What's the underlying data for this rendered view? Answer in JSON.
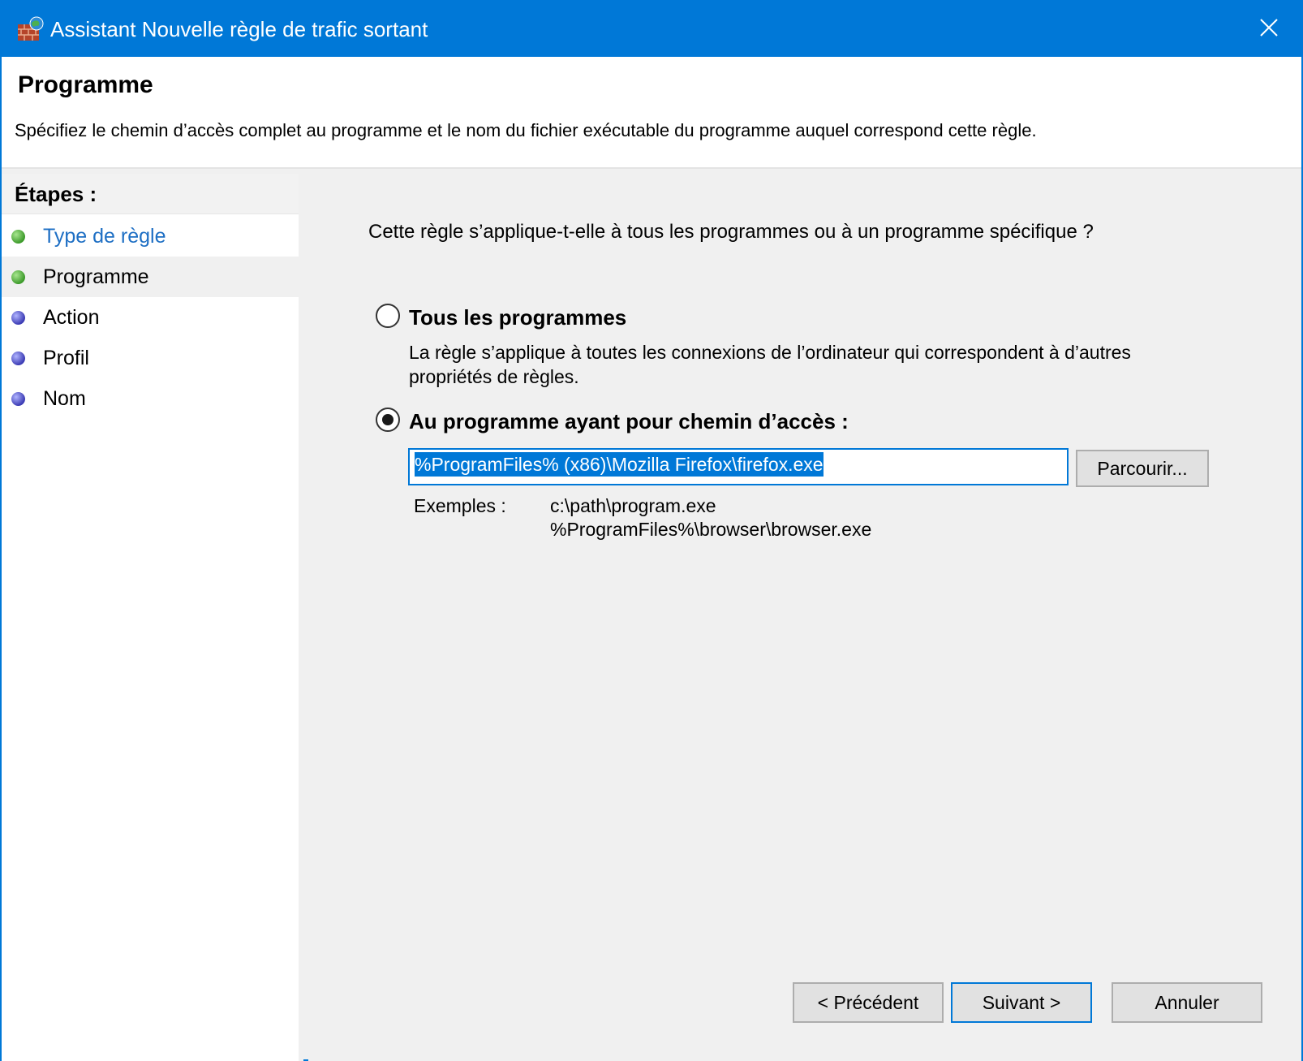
{
  "window": {
    "title": "Assistant Nouvelle règle de trafic sortant",
    "accent_color": "#0078d7"
  },
  "header": {
    "title": "Programme",
    "description": "Spécifiez le chemin d’accès complet au programme et le nom du fichier exécutable du programme auquel correspond cette règle."
  },
  "sidebar": {
    "title": "Étapes :",
    "items": [
      {
        "label": "Type de règle",
        "state": "completed-link",
        "dot": "green"
      },
      {
        "label": "Programme",
        "state": "current",
        "dot": "green"
      },
      {
        "label": "Action",
        "state": "pending",
        "dot": "blue"
      },
      {
        "label": "Profil",
        "state": "pending",
        "dot": "blue"
      },
      {
        "label": "Nom",
        "state": "pending",
        "dot": "blue"
      }
    ]
  },
  "main": {
    "question": "Cette règle s’applique-t-elle à tous les programmes ou à un programme spécifique ?",
    "option_all": {
      "label": "Tous les programmes",
      "description": "La règle s’applique à toutes les connexions de l’ordinateur qui correspondent à d’autres propriétés de règles.",
      "checked": false
    },
    "option_path": {
      "label": "Au programme ayant pour chemin d’accès :",
      "checked": true
    },
    "path_value": "%ProgramFiles% (x86)\\Mozilla Firefox\\firefox.exe",
    "browse_label": "Parcourir...",
    "examples_label": "Exemples :",
    "examples": [
      "c:\\path\\program.exe",
      "%ProgramFiles%\\browser\\browser.exe"
    ]
  },
  "buttons": {
    "previous": "< Précédent",
    "next": "Suivant >",
    "cancel": "Annuler"
  },
  "icons": {
    "title": "firewall-icon",
    "close": "close-icon"
  }
}
